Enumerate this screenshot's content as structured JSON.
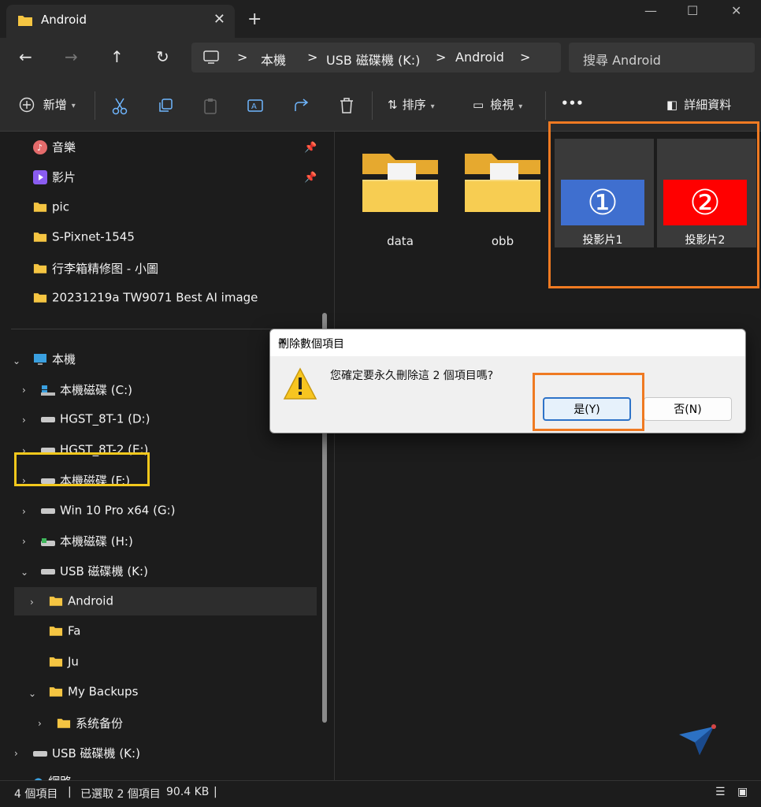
{
  "window": {
    "tab_title": "Android",
    "new_tab_glyph": "+",
    "close_tab_glyph": "✕",
    "minimize_glyph": "—",
    "maximize_glyph": "☐",
    "close_glyph": "✕"
  },
  "nav": {
    "back_icon": "←",
    "forward_icon": "→",
    "up_icon": "↑",
    "refresh_icon": "↻",
    "breadcrumb": [
      "本機",
      "USB 磁碟機 (K:)",
      "Android"
    ],
    "separator": ">",
    "search_placeholder": "搜尋 Android"
  },
  "toolbar": {
    "new_label": "新增",
    "sort_label": "排序",
    "view_label": "檢視",
    "more_label": "•••",
    "details_label": "詳細資料"
  },
  "sidebar": {
    "pinned": [
      {
        "label": "音樂",
        "icon": "music-icon"
      },
      {
        "label": "影片",
        "icon": "video-icon"
      },
      {
        "label": "pic",
        "icon": "folder-icon"
      },
      {
        "label": "S-Pixnet-1545",
        "icon": "folder-icon"
      },
      {
        "label": "行李箱精修图 - 小圖",
        "icon": "folder-icon"
      },
      {
        "label": "20231219a TW9071 Best AI image",
        "icon": "folder-icon"
      }
    ],
    "this_pc": "本機",
    "drives": [
      {
        "label": "本機磁碟 (C:)",
        "icon": "windows-drive-icon"
      },
      {
        "label": "HGST_8T-1 (D:)",
        "icon": "drive-icon"
      },
      {
        "label": "HGST_8T-2 (E:)",
        "icon": "drive-icon"
      },
      {
        "label": "本機磁碟 (F:)",
        "icon": "drive-icon"
      },
      {
        "label": "Win 10 Pro x64 (G:)",
        "icon": "drive-icon"
      },
      {
        "label": "本機磁碟 (H:)",
        "icon": "drive-icon"
      },
      {
        "label": "USB 磁碟機 (K:)",
        "icon": "drive-icon"
      }
    ],
    "usb_children": [
      "Android",
      "Fa",
      "Ju",
      "My Backups",
      "系统备份"
    ],
    "usb_root": "USB 磁碟機 (K:)",
    "partial_label": "網路"
  },
  "content": {
    "folders": [
      "data",
      "obb"
    ],
    "slides": [
      {
        "caption": "投影片1",
        "glyph": "①",
        "color": "#3f6fcf"
      },
      {
        "caption": "投影片2",
        "glyph": "②",
        "color": "#ff0000"
      }
    ]
  },
  "status": {
    "count": "4 個項目",
    "selected": "已選取 2 個項目",
    "size": "90.4 KB"
  },
  "dialog": {
    "title": "刪除數個項目",
    "message": "您確定要永久刪除這 2 個項目嗎?",
    "yes_label": "是(Y)",
    "no_label": "否(N)"
  },
  "colors": {
    "highlight_orange": "#ef7a22",
    "highlight_yellow": "#f2c81c",
    "folder_yellow": "#f5c542"
  }
}
